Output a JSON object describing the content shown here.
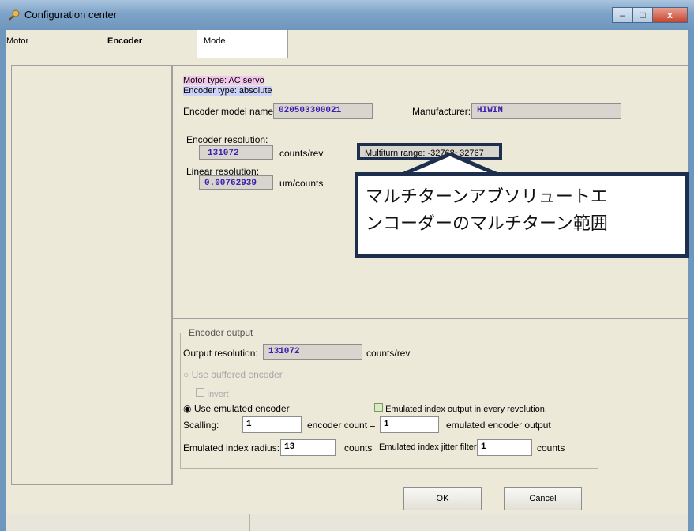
{
  "window": {
    "title": "Configuration center",
    "minimize": "–",
    "maximize": "□",
    "close": "x"
  },
  "tabs": [
    "Motor",
    "Encoder",
    "Mode"
  ],
  "info": {
    "motor_type": "Motor type: AC servo",
    "encoder_type": "Encoder type: absolute"
  },
  "encoder": {
    "model_label": "Encoder model name:",
    "model_value": "020503300021",
    "manufacturer_label": "Manufacturer:",
    "manufacturer_value": "HIWIN",
    "resolution_label": "Encoder resolution:",
    "resolution_value": "131072",
    "resolution_unit": "counts/rev",
    "multiturn_range": "Multiturn range: -32768~32767",
    "linear_label": "Linear resolution:",
    "linear_value": "0.00762939",
    "linear_unit": "um/counts"
  },
  "callout": {
    "line1": "マルチターンアブソリュートエ",
    "line2": "ンコーダーのマルチターン範囲"
  },
  "output": {
    "group_title": "Encoder output",
    "resolution_label": "Output resolution:",
    "resolution_value": "131072",
    "resolution_unit": "counts/rev",
    "buffered_label": "Use buffered encoder",
    "invert_label": "Invert",
    "emulated_label": "Use emulated encoder",
    "index_every_rev_label": "Emulated index output in every revolution.",
    "scalling_label": "Scalling:",
    "scalling_value": "1",
    "encoder_count_label": "encoder count =",
    "encoder_count_value": "1",
    "emulated_output_label": "emulated encoder output",
    "index_radius_label": "Emulated index radius:",
    "index_radius_value": "13",
    "index_radius_unit": "counts",
    "jitter_label": "Emulated index jitter filter:",
    "jitter_value": "1",
    "jitter_unit": "counts"
  },
  "buttons": {
    "ok": "OK",
    "cancel": "Cancel"
  }
}
